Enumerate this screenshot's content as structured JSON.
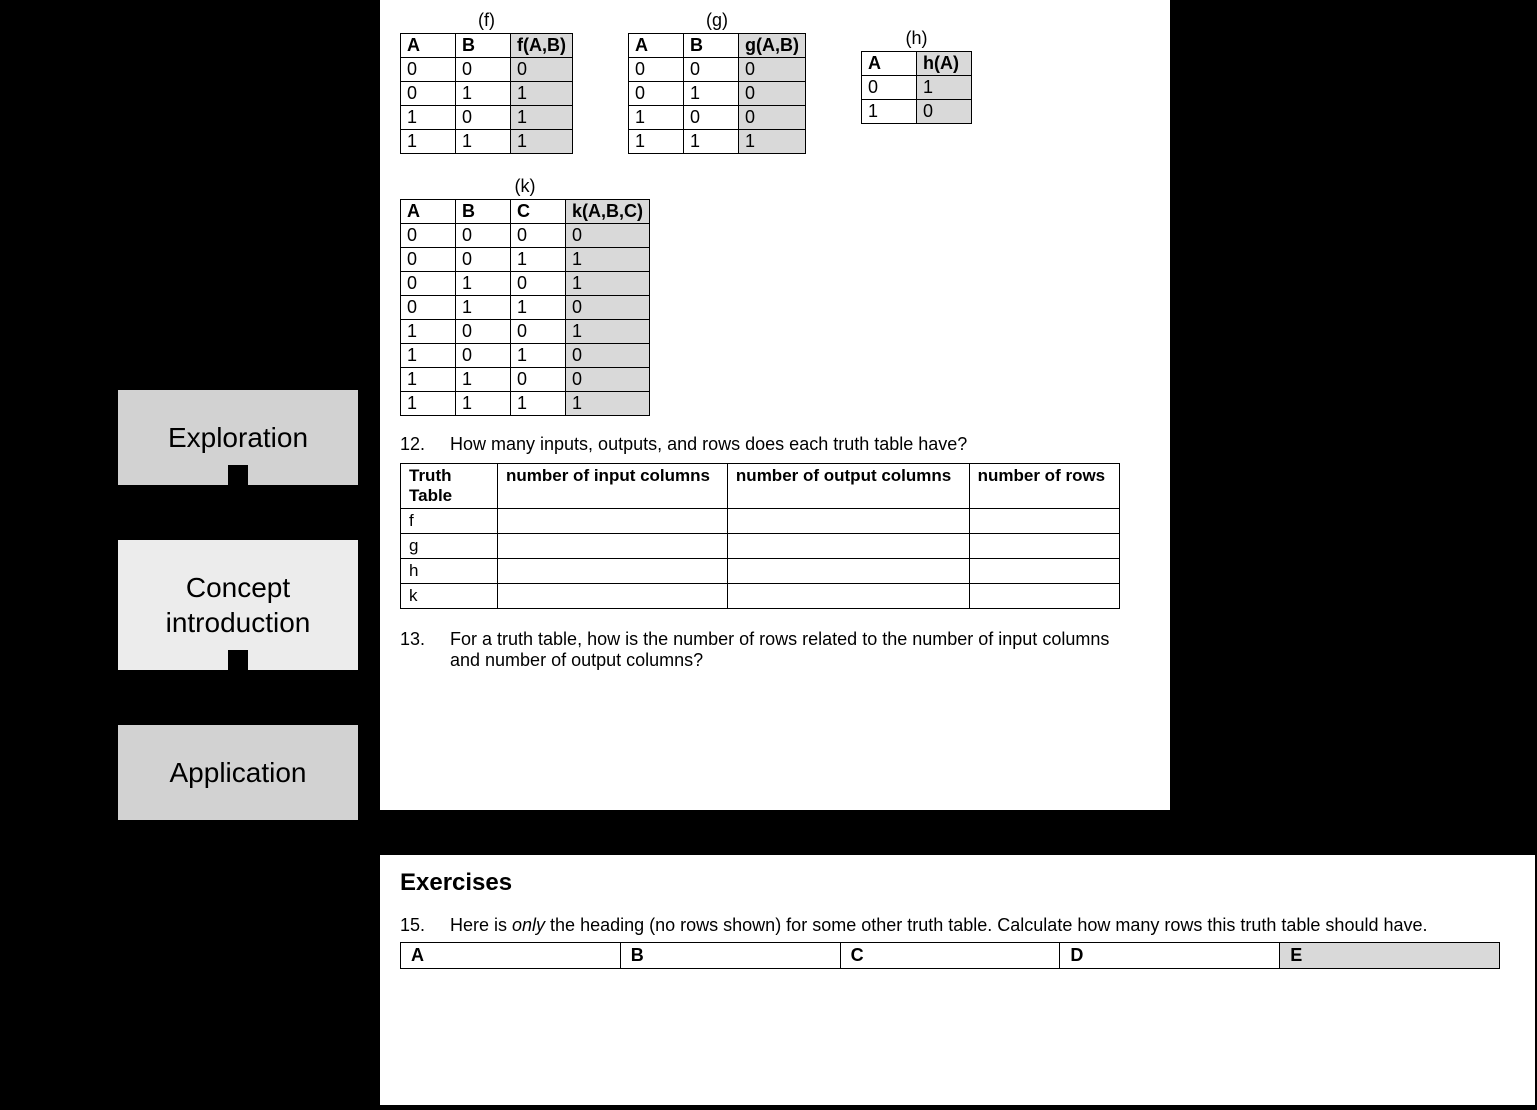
{
  "sidebar": {
    "phases": [
      "Exploration",
      "Concept introduction",
      "Application"
    ]
  },
  "tables": {
    "f": {
      "label": "(f)",
      "headers": [
        "A",
        "B",
        "f(A,B)"
      ],
      "out_index": 2,
      "rows": [
        [
          "0",
          "0",
          "0"
        ],
        [
          "0",
          "1",
          "1"
        ],
        [
          "1",
          "0",
          "1"
        ],
        [
          "1",
          "1",
          "1"
        ]
      ]
    },
    "g": {
      "label": "(g)",
      "headers": [
        "A",
        "B",
        "g(A,B)"
      ],
      "out_index": 2,
      "rows": [
        [
          "0",
          "0",
          "0"
        ],
        [
          "0",
          "1",
          "0"
        ],
        [
          "1",
          "0",
          "0"
        ],
        [
          "1",
          "1",
          "1"
        ]
      ]
    },
    "h": {
      "label": "(h)",
      "headers": [
        "A",
        "h(A)"
      ],
      "out_index": 1,
      "rows": [
        [
          "0",
          "1"
        ],
        [
          "1",
          "0"
        ]
      ]
    },
    "k": {
      "label": "(k)",
      "headers": [
        "A",
        "B",
        "C",
        "k(A,B,C)"
      ],
      "out_index": 3,
      "rows": [
        [
          "0",
          "0",
          "0",
          "0"
        ],
        [
          "0",
          "0",
          "1",
          "1"
        ],
        [
          "0",
          "1",
          "0",
          "1"
        ],
        [
          "0",
          "1",
          "1",
          "0"
        ],
        [
          "1",
          "0",
          "0",
          "1"
        ],
        [
          "1",
          "0",
          "1",
          "0"
        ],
        [
          "1",
          "1",
          "0",
          "0"
        ],
        [
          "1",
          "1",
          "1",
          "1"
        ]
      ]
    }
  },
  "q12": {
    "number": "12.",
    "text": "How many inputs, outputs, and rows does each truth table have?",
    "headers": [
      "Truth Table",
      "number of input columns",
      "number of output columns",
      "number of rows"
    ],
    "row_labels": [
      "f",
      "g",
      "h",
      "k"
    ]
  },
  "q13": {
    "number": "13.",
    "text": "For a truth table, how is the number of rows related to the number of input columns and number of output columns?"
  },
  "exercises": {
    "title": "Exercises",
    "q15": {
      "number": "15.",
      "text_before": "Here is ",
      "italic": "only",
      "text_after": " the heading (no rows shown) for some other truth table. Calculate how many rows this truth table should have.",
      "headers": [
        "A",
        "B",
        "C",
        "D",
        "E"
      ],
      "out_index": 4
    }
  }
}
